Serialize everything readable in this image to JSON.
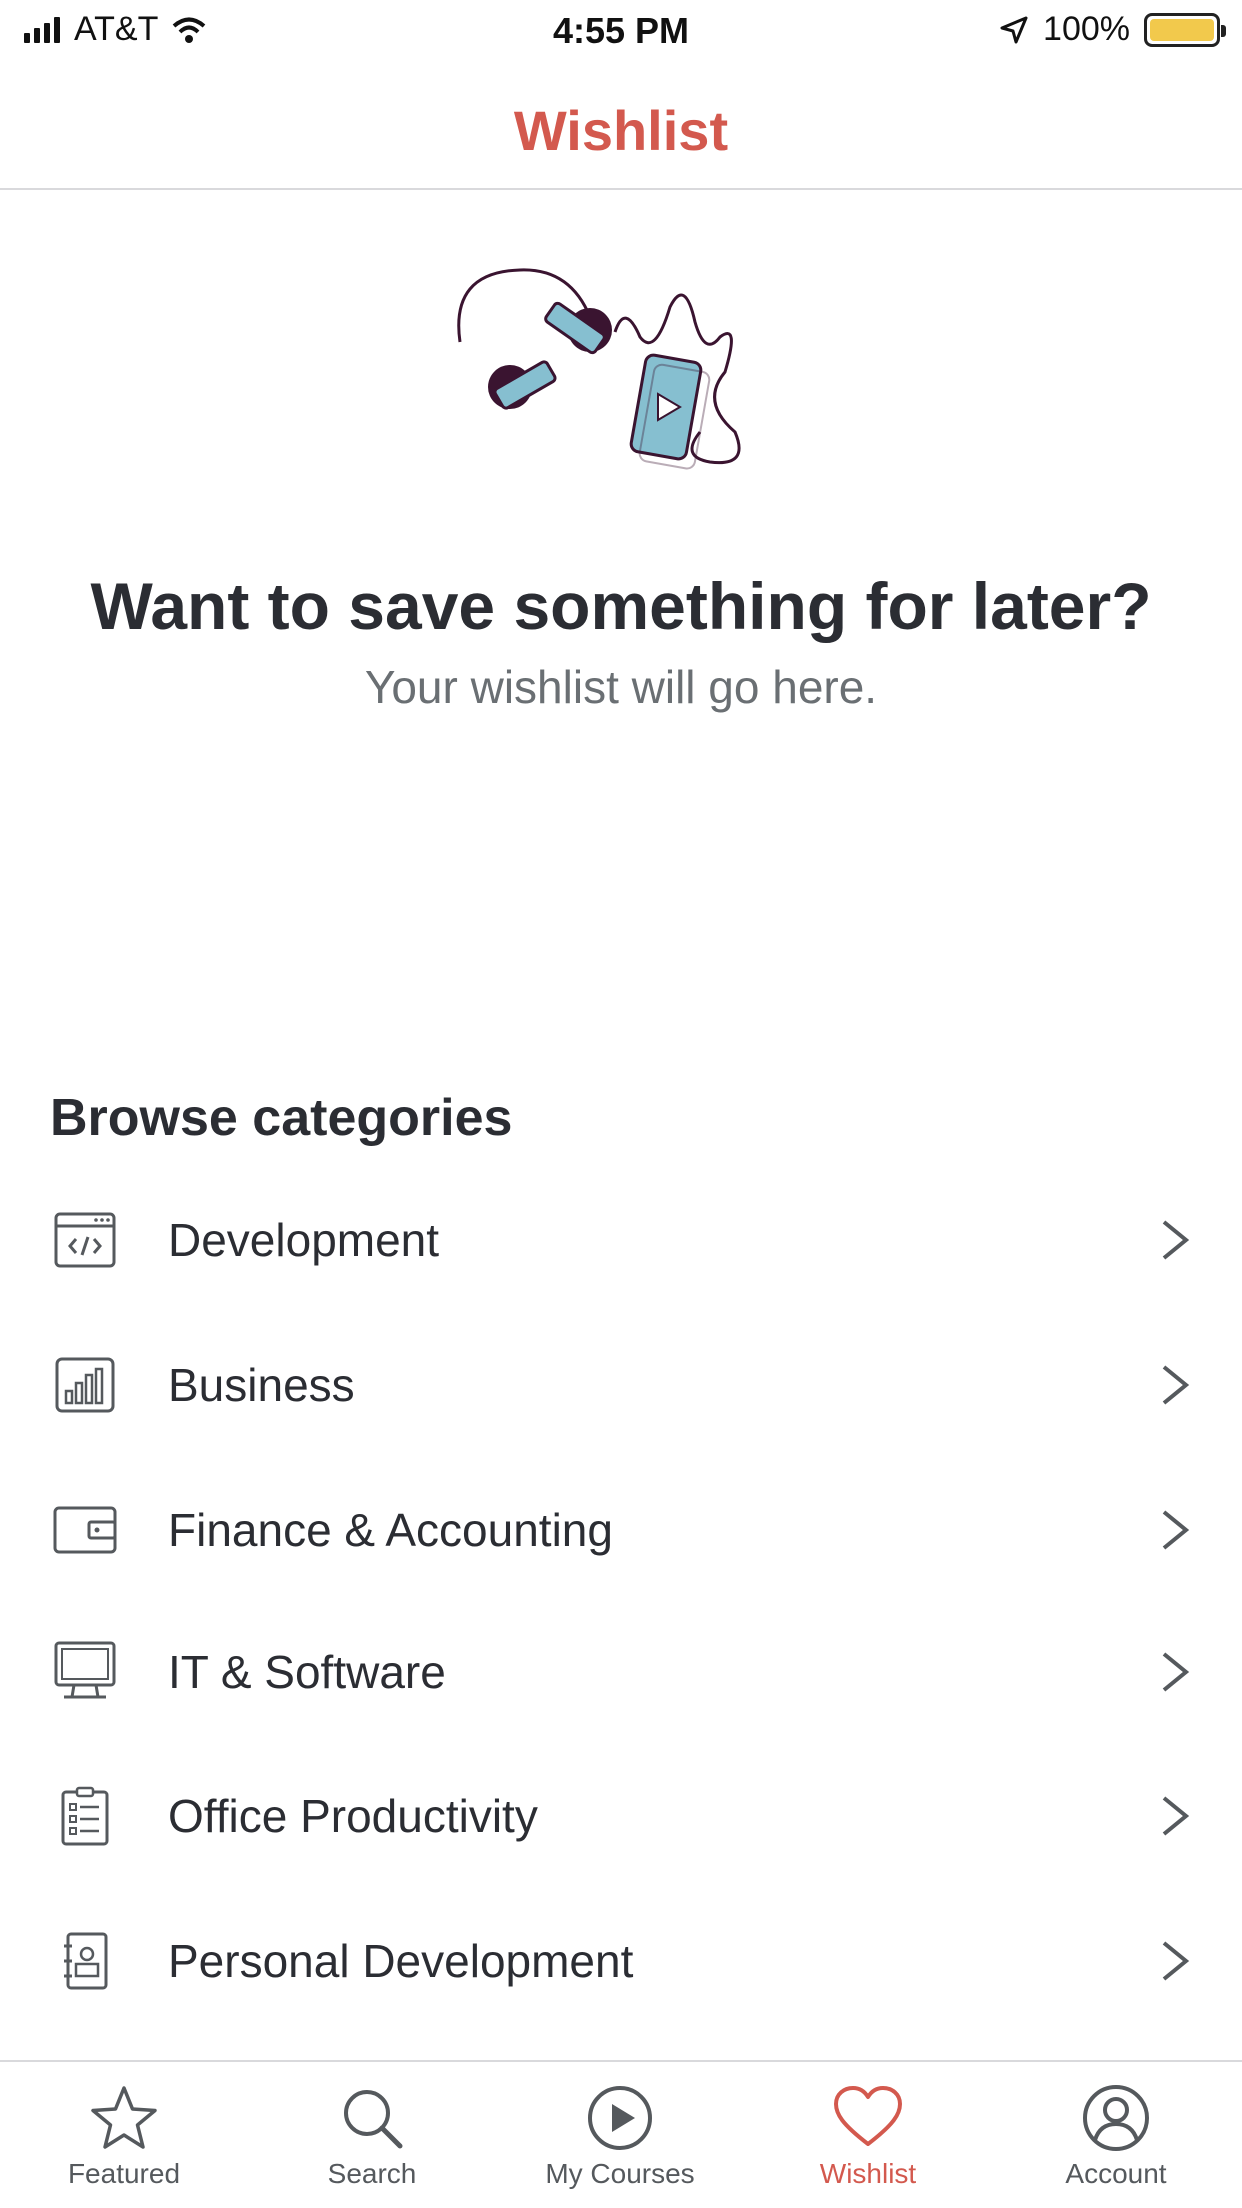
{
  "status_bar": {
    "carrier": "AT&T",
    "time": "4:55 PM",
    "battery": "100%"
  },
  "header": {
    "title": "Wishlist"
  },
  "empty_state": {
    "heading": "Want to save something for later?",
    "subtext": "Your wishlist will go here.",
    "illustration": "headphones-and-phone-illustration"
  },
  "browse": {
    "title": "Browse categories",
    "categories": [
      {
        "label": "Development",
        "icon": "code-window-icon"
      },
      {
        "label": "Business",
        "icon": "bar-chart-icon"
      },
      {
        "label": "Finance & Accounting",
        "icon": "wallet-icon"
      },
      {
        "label": "IT & Software",
        "icon": "monitor-icon"
      },
      {
        "label": "Office Productivity",
        "icon": "checklist-icon"
      },
      {
        "label": "Personal Development",
        "icon": "id-card-icon"
      }
    ]
  },
  "tab_bar": {
    "tabs": [
      {
        "label": "Featured",
        "icon": "star-icon",
        "active": false
      },
      {
        "label": "Search",
        "icon": "search-icon",
        "active": false
      },
      {
        "label": "My Courses",
        "icon": "play-circle-icon",
        "active": false
      },
      {
        "label": "Wishlist",
        "icon": "heart-icon",
        "active": true
      },
      {
        "label": "Account",
        "icon": "user-circle-icon",
        "active": false
      }
    ]
  },
  "colors": {
    "accent": "#d3594e",
    "text": "#2b2d33",
    "muted": "#6a6f73",
    "battery": "#f2c94c",
    "illustration_blue": "#86bfd0",
    "illustration_dark": "#3a1430"
  }
}
